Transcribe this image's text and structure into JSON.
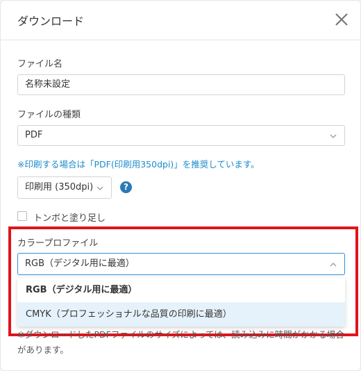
{
  "dialog": {
    "title": "ダウンロード"
  },
  "file_name": {
    "label": "ファイル名",
    "value": "名称未設定"
  },
  "file_type": {
    "label": "ファイルの種類",
    "value": "PDF"
  },
  "print_note": "※印刷する場合は「PDF(印刷用350dpi)」を推奨しています。",
  "resolution": {
    "value": "印刷用 (350dpi)"
  },
  "help": {
    "glyph": "?"
  },
  "trim_marks": {
    "label": "トンボと塗り足し",
    "checked": false
  },
  "color_profile": {
    "label": "カラープロファイル",
    "value": "RGB（デジタル用に最適）",
    "options": [
      "RGB（デジタル用に最適）",
      "CMYK（プロフェッショナルな品質の印刷に最適）"
    ]
  },
  "footer_note": "※ダウンロードしたPDFファイルのサイズによっては、読み込みに時間がかかる場合があります。",
  "colors": {
    "accent": "#1a8ccc",
    "highlight": "#e0141b",
    "help": "#2a7ab8"
  }
}
